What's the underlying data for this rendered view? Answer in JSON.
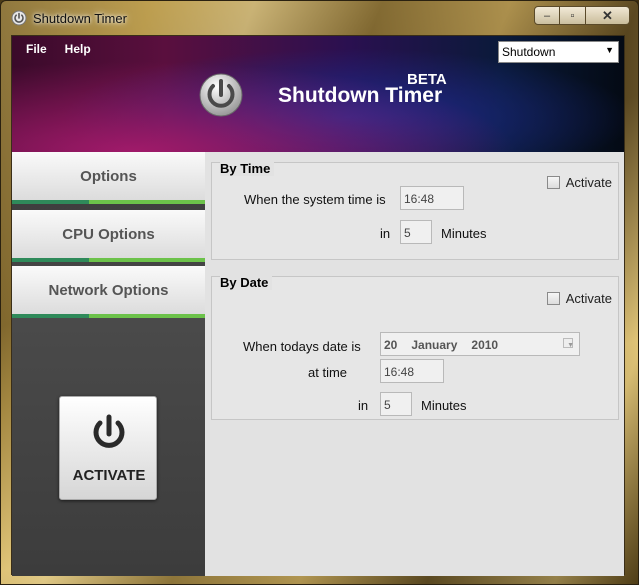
{
  "window": {
    "title": "Shutdown Timer",
    "minimize_glyph": "–",
    "maximize_glyph": "▫",
    "close_glyph": "✕"
  },
  "menu": {
    "file": "File",
    "help": "Help"
  },
  "action_select": {
    "value": "Shutdown",
    "arrow_glyph": "▼"
  },
  "banner": {
    "title": "Shutdown Timer",
    "badge": "BETA"
  },
  "sidebar": {
    "tabs": [
      {
        "label": "Options"
      },
      {
        "label": "CPU Options"
      },
      {
        "label": "Network Options"
      }
    ],
    "activate_label": "ACTIVATE"
  },
  "by_time": {
    "title": "By Time",
    "activate_label": "Activate",
    "system_time_label": "When the system time is",
    "system_time_value": "16:48",
    "in_label": "in",
    "minutes_value": "5",
    "minutes_label": "Minutes"
  },
  "by_date": {
    "title": "By Date",
    "activate_label": "Activate",
    "date_label": "When todays date is",
    "date_day": "20",
    "date_month": "January",
    "date_year": "2010",
    "at_time_label": "at time",
    "time_value": "16:48",
    "in_label": "in",
    "minutes_value": "5",
    "minutes_label": "Minutes"
  },
  "colors": {
    "accent_green": "#6cc24a",
    "accent_teal": "#2f8a5a",
    "sidebar_dark": "#3a3a3a"
  },
  "icons": {
    "app": "power-icon",
    "activate": "power-icon"
  }
}
